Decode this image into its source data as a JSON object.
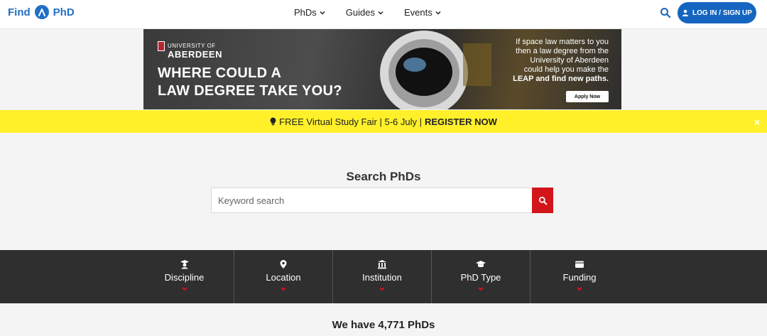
{
  "header": {
    "logo_left": "Find",
    "logo_right": "PhD",
    "nav": [
      {
        "label": "PhDs"
      },
      {
        "label": "Guides"
      },
      {
        "label": "Events"
      }
    ],
    "login_label": "LOG IN / SIGN UP"
  },
  "banner": {
    "university_small": "UNIVERSITY OF",
    "university_big": "ABERDEEN",
    "headline_1": "WHERE COULD A",
    "headline_2": "LAW DEGREE TAKE YOU?",
    "copy_1": "If space law matters to you",
    "copy_2": "then a law degree from the",
    "copy_3": "University of Aberdeen",
    "copy_4": "could help you make the",
    "copy_5": "LEAP and find new paths.",
    "apply_label": "Apply Now"
  },
  "fair": {
    "text": "FREE Virtual Study Fair | 5-6 July |",
    "cta": "REGISTER NOW",
    "close": "×"
  },
  "search": {
    "title": "Search PhDs",
    "placeholder": "Keyword search"
  },
  "categories": [
    {
      "label": "Discipline",
      "icon": "graduate-icon"
    },
    {
      "label": "Location",
      "icon": "map-pin-icon"
    },
    {
      "label": "Institution",
      "icon": "institution-icon"
    },
    {
      "label": "PhD Type",
      "icon": "mortarboard-icon"
    },
    {
      "label": "Funding",
      "icon": "wallet-icon"
    }
  ],
  "count_text": "We have 4,771 PhDs",
  "colors": {
    "brand_blue": "#1565c0",
    "accent_red": "#d4141b",
    "fair_yellow": "#fff02a",
    "catbar": "#2f2f2f"
  }
}
